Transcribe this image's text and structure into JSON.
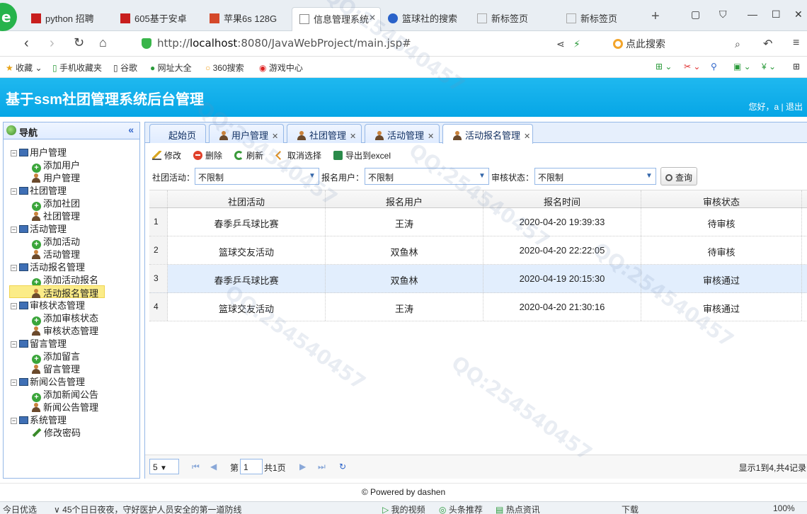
{
  "browser": {
    "tabs": [
      {
        "label": "python 招聘",
        "fav": "#c81e1e"
      },
      {
        "label": "605基于安卓",
        "fav": "#c81e1e"
      },
      {
        "label": "苹果6s 128G",
        "fav": "#d4482a"
      },
      {
        "label": "信息管理系统",
        "fav": "#8aa"
      },
      {
        "label": "篮球社的搜索",
        "fav": "#2a62c9"
      },
      {
        "label": "新标签页",
        "fav": "#9aa"
      },
      {
        "label": "新标签页",
        "fav": "#9aa"
      }
    ],
    "url_prefix": "http://",
    "url_host": "localhost",
    "url_rest": ":8080/JavaWebProject/main.jsp#",
    "search_placeholder": "点此搜索",
    "bookmarks": [
      "收藏",
      "手机收藏夹",
      "谷歌",
      "网址大全",
      "360搜索",
      "游戏中心"
    ]
  },
  "app": {
    "title": "基于ssm社团管理系统后台管理",
    "user_greeting": "您好，a | 退出"
  },
  "nav": {
    "title": "导航",
    "tree": [
      {
        "label": "用户管理",
        "level": 1
      },
      {
        "label": "添加用户",
        "level": 2,
        "icon": "add"
      },
      {
        "label": "用户管理",
        "level": 2,
        "icon": "person"
      },
      {
        "label": "社团管理",
        "level": 1
      },
      {
        "label": "添加社团",
        "level": 2,
        "icon": "add"
      },
      {
        "label": "社团管理",
        "level": 2,
        "icon": "person"
      },
      {
        "label": "活动管理",
        "level": 1
      },
      {
        "label": "添加活动",
        "level": 2,
        "icon": "add"
      },
      {
        "label": "活动管理",
        "level": 2,
        "icon": "person"
      },
      {
        "label": "活动报名管理",
        "level": 1
      },
      {
        "label": "添加活动报名",
        "level": 2,
        "icon": "add"
      },
      {
        "label": "活动报名管理",
        "level": 2,
        "icon": "person",
        "selected": true
      },
      {
        "label": "审核状态管理",
        "level": 1
      },
      {
        "label": "添加审核状态",
        "level": 2,
        "icon": "add"
      },
      {
        "label": "审核状态管理",
        "level": 2,
        "icon": "person"
      },
      {
        "label": "留言管理",
        "level": 1
      },
      {
        "label": "添加留言",
        "level": 2,
        "icon": "add"
      },
      {
        "label": "留言管理",
        "level": 2,
        "icon": "person"
      },
      {
        "label": "新闻公告管理",
        "level": 1
      },
      {
        "label": "添加新闻公告",
        "level": 2,
        "icon": "add"
      },
      {
        "label": "新闻公告管理",
        "level": 2,
        "icon": "person"
      },
      {
        "label": "系统管理",
        "level": 1
      },
      {
        "label": "修改密码",
        "level": 2,
        "icon": "pencil"
      }
    ]
  },
  "content_tabs": [
    {
      "label": "起始页",
      "closable": false
    },
    {
      "label": "用户管理",
      "closable": true
    },
    {
      "label": "社团管理",
      "closable": true
    },
    {
      "label": "活动管理",
      "closable": true
    },
    {
      "label": "活动报名管理",
      "closable": true,
      "active": true
    }
  ],
  "toolbar": {
    "edit": "修改",
    "delete": "删除",
    "refresh": "刷新",
    "cancel_select": "取消选择",
    "export": "导出到excel"
  },
  "filters": {
    "activity_label": "社团活动：",
    "activity_value": "不限制",
    "user_label": "报名用户：",
    "user_value": "不限制",
    "status_label": "审核状态：",
    "status_value": "不限制",
    "query": "查询"
  },
  "table": {
    "columns": [
      "社团活动",
      "报名用户",
      "报名时间",
      "审核状态"
    ],
    "rows": [
      {
        "num": "1",
        "activity": "春季乒乓球比赛",
        "user": "王涛",
        "time": "2020-04-20 19:39:33",
        "status": "待审核"
      },
      {
        "num": "2",
        "activity": "篮球交友活动",
        "user": "双鱼林",
        "time": "2020-04-20 22:22:05",
        "status": "待审核"
      },
      {
        "num": "3",
        "activity": "春季乒乓球比赛",
        "user": "双鱼林",
        "time": "2020-04-19 20:15:30",
        "status": "审核通过"
      },
      {
        "num": "4",
        "activity": "篮球交友活动",
        "user": "王涛",
        "time": "2020-04-20 21:30:16",
        "status": "审核通过"
      }
    ]
  },
  "pager": {
    "page_size": "5",
    "page_prefix": "第",
    "page_value": "1",
    "page_total": "共1页",
    "summary": "显示1到4,共4记录"
  },
  "footer": "© Powered by dashen",
  "statusbar": {
    "left": "今日优选",
    "news": "45个日日夜夜，守好医护人员安全的第一道防线",
    "items": [
      "我的视频",
      "头条推荐",
      "热点资讯",
      "下载",
      "100%"
    ]
  }
}
